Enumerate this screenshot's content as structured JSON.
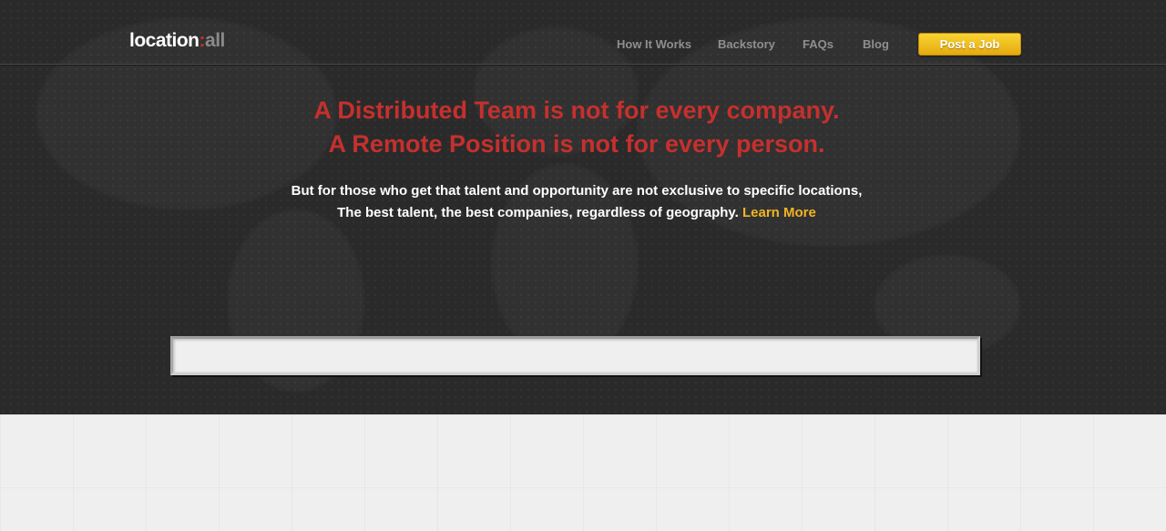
{
  "header": {
    "logo": {
      "main": "location",
      "colon": ":",
      "sub": "all"
    },
    "nav": [
      {
        "label": "How It Works"
      },
      {
        "label": "Backstory"
      },
      {
        "label": "FAQs"
      },
      {
        "label": "Blog"
      }
    ],
    "post_job_label": "Post a Job"
  },
  "hero": {
    "headline_line1": "A Distributed Team is not for every company.",
    "headline_line2": "A Remote Position is not for every person.",
    "sub_line1": "But for those who get that talent and opportunity are not exclusive to specific locations,",
    "sub_line2": "The best talent, the best companies, regardless of geography.",
    "learn_more_label": "Learn More"
  },
  "search": {
    "value": "",
    "placeholder": ""
  },
  "colors": {
    "accent_red": "#c5302e",
    "accent_yellow": "#f0b424",
    "hero_bg": "#2a2a2a",
    "page_bg": "#efefef"
  }
}
